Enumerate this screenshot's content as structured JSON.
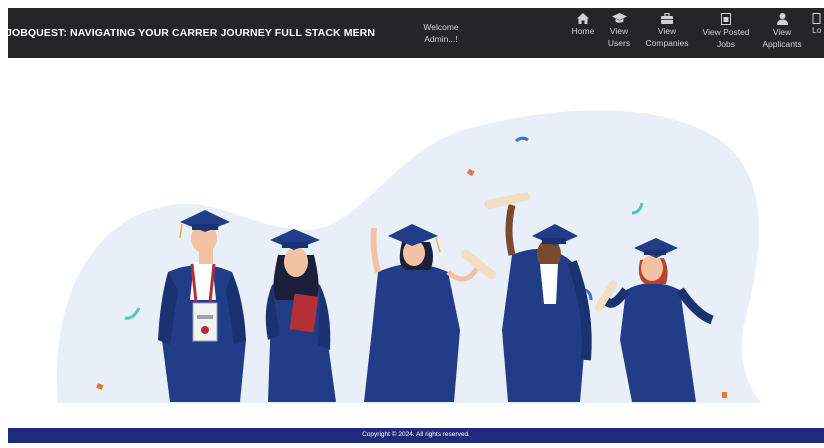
{
  "navbar": {
    "brand": "JOBQUEST: NAVIGATING YOUR CARRER JOURNEY FULL STACK MERN",
    "welcome_line1": "Welcome",
    "welcome_line2": "Admin...!",
    "items": [
      {
        "line1": "",
        "line2": "Home",
        "icon": "home-icon"
      },
      {
        "line1": "View",
        "line2": "Users",
        "icon": "graduation-cap-icon"
      },
      {
        "line1": "View",
        "line2": "Companies",
        "icon": "briefcase-icon"
      },
      {
        "line1": "View Posted",
        "line2": "Jobs",
        "icon": "document-icon"
      },
      {
        "line1": "View",
        "line2": "Applicants",
        "icon": "user-icon"
      },
      {
        "line1": "",
        "line2": "Lo",
        "icon": "logout-icon"
      }
    ]
  },
  "hero": {
    "image": "graduates-illustration"
  },
  "footer": {
    "text": "Copyright © 2024. All rights reserved."
  },
  "colors": {
    "navbar": "#232527",
    "footer": "#1e2b78",
    "gown": "#223d87",
    "blob": "#e8eff8"
  }
}
